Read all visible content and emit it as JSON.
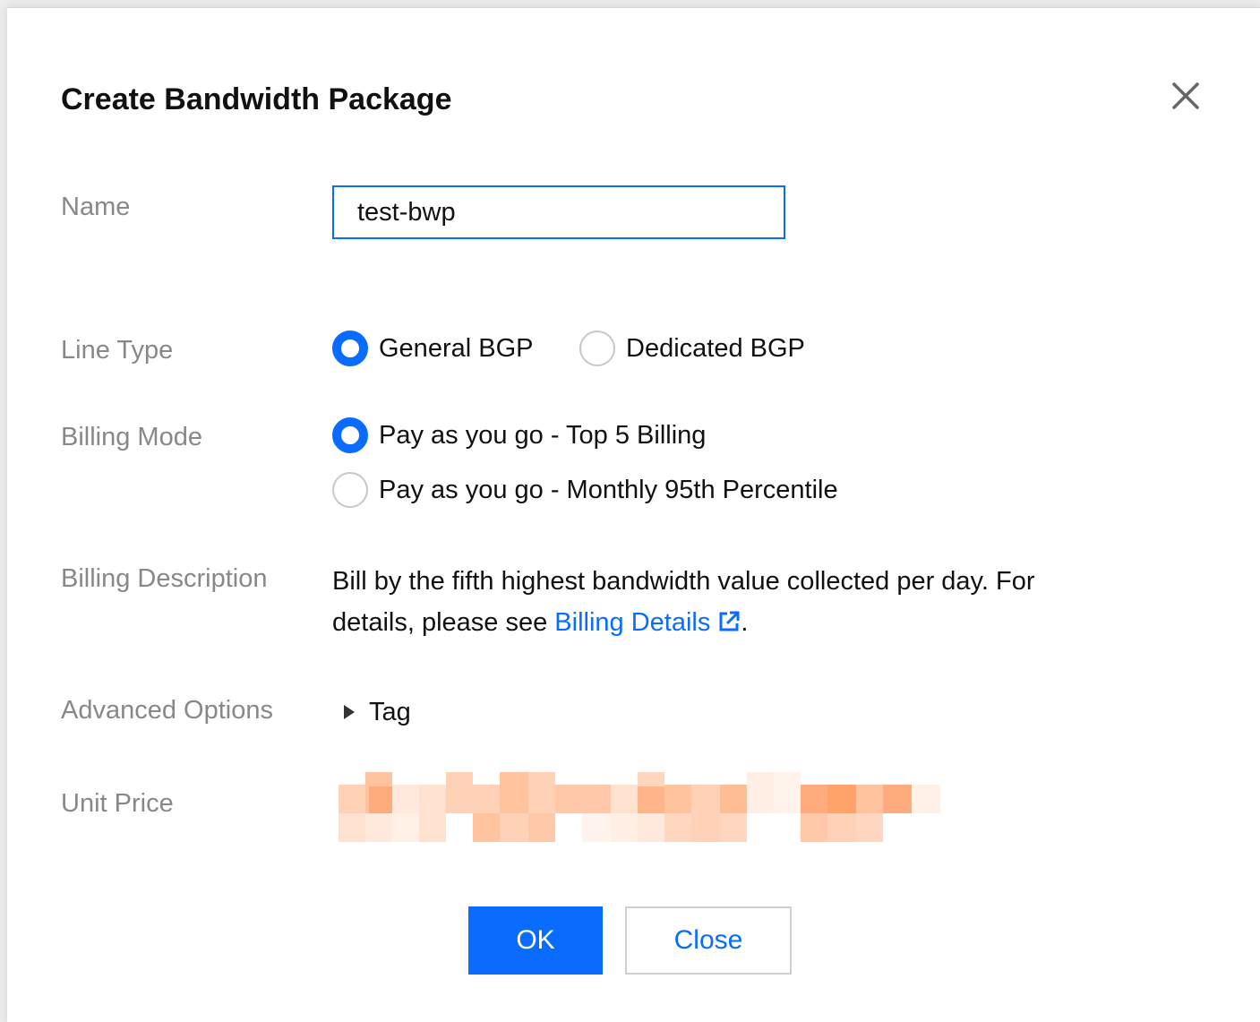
{
  "dialog": {
    "title": "Create Bandwidth Package",
    "close_icon": "close-icon"
  },
  "form": {
    "name": {
      "label": "Name",
      "value": "test-bwp"
    },
    "line_type": {
      "label": "Line Type",
      "options": [
        {
          "label": "General BGP",
          "checked": true
        },
        {
          "label": "Dedicated BGP",
          "checked": false
        }
      ]
    },
    "billing_mode": {
      "label": "Billing Mode",
      "options": [
        {
          "label": "Pay as you go - Top 5 Billing",
          "checked": true
        },
        {
          "label": "Pay as you go - Monthly 95th Percentile",
          "checked": false
        }
      ]
    },
    "billing_description": {
      "label": "Billing Description",
      "text": "Bill by the fifth highest bandwidth value collected per day. For details, please see",
      "link_text": "Billing Details",
      "link_icon": "external-link-icon",
      "suffix": "."
    },
    "advanced_options": {
      "label": "Advanced Options",
      "toggle_label": "Tag",
      "toggle_icon": "triangle-right-icon"
    },
    "unit_price": {
      "label": "Unit Price"
    }
  },
  "buttons": {
    "ok": "OK",
    "close": "Close"
  },
  "colors": {
    "accent": "#0a6cff",
    "label": "#888888",
    "text": "#111111",
    "redaction": "#ffa36b"
  }
}
